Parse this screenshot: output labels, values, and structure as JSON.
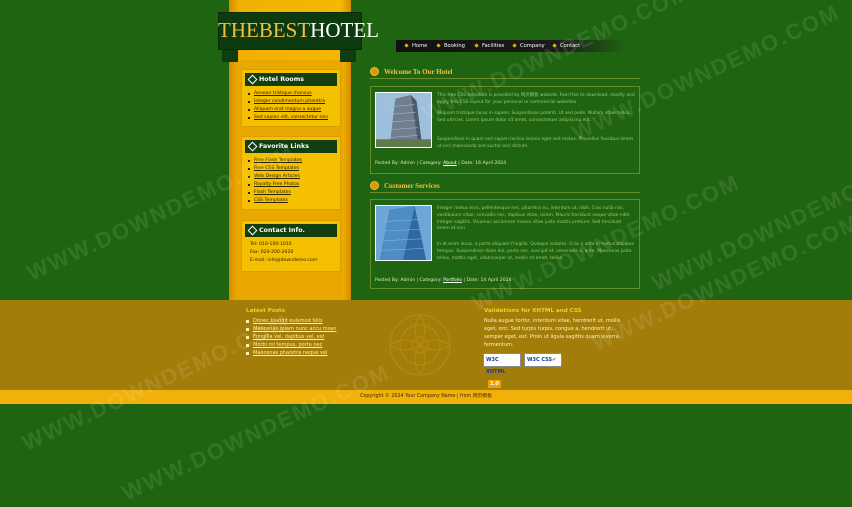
{
  "logo": {
    "part1": "THEBEST",
    "part2": "HOTEL"
  },
  "nav": [
    {
      "label": "Home"
    },
    {
      "label": "Booking"
    },
    {
      "label": "Facilities"
    },
    {
      "label": "Company"
    },
    {
      "label": "Contact"
    }
  ],
  "sidebar": {
    "hotel_rooms": {
      "title": "Hotel Rooms",
      "items": [
        "Aenean tristique rhoncus",
        "Integer condimentum pharetra",
        "Aliquam erat magna a augue",
        "Sed sapien elit, consectetur non"
      ]
    },
    "favorite_links": {
      "title": "Favorite Links",
      "items": [
        "Free Flash Templates",
        "Free CSS Templates",
        "Web Design Articles",
        "Royalty Free Photos",
        "Flash Templates",
        "CSS Templates"
      ]
    },
    "contact": {
      "title": "Contact Info.",
      "items": [
        "Tel: 010-100-1010",
        "Fax: 020-200-2020",
        "E-mail: info@downdemo.com"
      ]
    }
  },
  "main": {
    "welcome": {
      "title": "Welcome To Our Hotel",
      "p1": "This free CSS template is provided by 网页模板 website. Feel free to download, modify and apply this CSS layout for your personal or commercial websites.",
      "p2": "Aliquam tristique lacus in sapien. Suspendisse potenti. Ut sed pede. Nullam vitae tellus. Sed ultrices. Lorem ipsum dolor sit amet, consectetuer adipiscing elit.",
      "p3": "Suspendisse in quam sed sapien lacinia lacinia eget sed metus. Phasellus faucibus lorem ut orci malesuada sed auctor orci dictum.",
      "meta_prefix": "Posted By: Admin | Category:",
      "meta_category": "About",
      "meta_suffix": "| Date: 16 April 2024"
    },
    "services": {
      "title": "Customer Services",
      "p1": "Integer metus eros, pellentesque nec, pharetra eu, interdum ut, nibh. Cras nulla nisi, vestibulum vitae, convallis nec, dapibus vitae, lorem. Mauris tincidunt neque vitae nibh. Integer sagittis. Vivamus accumsan massa vitae justo mattis pretium. Sed tincidunt lorem et orci.",
      "p2": "In et enim lacus, a porta aliquam fringilla. Quisque sodales. Cras a ante in metus dapibus tempus. Suspendisse diam dui, porta nec, suscipit et, venenatis a, ante. Maecenas justo tellus, mattis eget, ullamcorper ut, mollis sit amet, tellus.",
      "meta_prefix": "Posted By: Admin | Category:",
      "meta_category": "Portfolio",
      "meta_suffix": "| Date: 14 April 2024"
    }
  },
  "footer": {
    "latest_posts": {
      "title": "Latest Posts",
      "items": [
        "Donec blandit euismod felis",
        "Maecenas quam nunc accu msan",
        "Fringilla vel, dapibus vel, est",
        "Morbi mi tempus, porta nec",
        "Maecenas pharetra neque vel"
      ]
    },
    "validations": {
      "title": "Validations for XHTML and CSS",
      "text": "Nulla augue tortor, interdum vitae, hendrerit ut, mollis eget, orci. Sed turpis turpis, congue a, hendrerit ut, semper eget, est. Proin ut ligula sagittis quam viverra fermentum.",
      "badge1": "W3C XHTML",
      "badge1_ver": "1.0",
      "badge2": "W3C CSS"
    },
    "copyright": "Copyright © 2024 Your Company Name | from 网页模板"
  },
  "watermark": "WWW.DOWNDEMO.COM"
}
